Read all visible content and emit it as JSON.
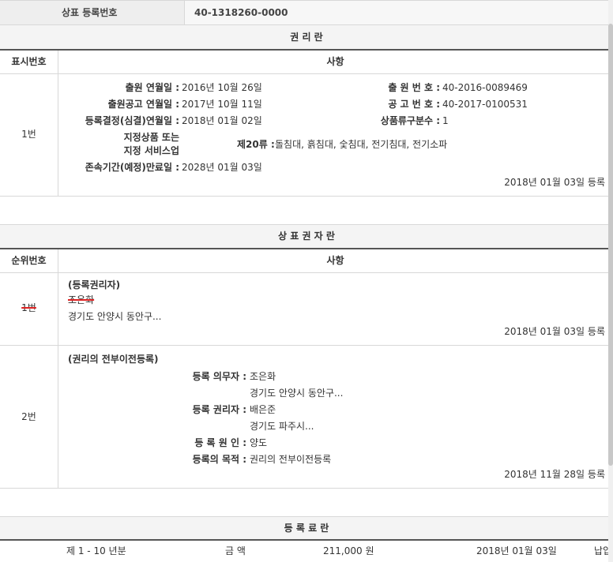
{
  "reg_header": {
    "label": "상표 등록번호",
    "value": "40-1318260-0000"
  },
  "rights": {
    "title": "권 리 란",
    "col_num": "표시번호",
    "col_content": "사항",
    "row_num": "1번",
    "fields_left": [
      {
        "label": "출원 연월일 :",
        "value": "2016년 10월 26일"
      },
      {
        "label": "출원공고 연월일 :",
        "value": "2017년 10월 11일"
      },
      {
        "label": "등록결정(심결)연월일 :",
        "value": "2018년 01월 02일"
      },
      {
        "label": "존속기간(예정)만료일 :",
        "value": "2028년 01월 03일"
      }
    ],
    "fields_right": [
      {
        "label": "출 원 번 호 :",
        "value": "40-2016-0089469"
      },
      {
        "label": "공 고 번 호 :",
        "value": "40-2017-0100531"
      },
      {
        "label": "상품류구분수 :",
        "value": "1"
      }
    ],
    "designated_label_1": "지정상품 또는",
    "designated_label_2": "지정 서비스업",
    "designated_class": "제20류 :",
    "designated_items": "돌침대, 흙침대, 숯침대, 전기침대, 전기소파",
    "reg_date": "2018년 01월 03일 등록"
  },
  "owners": {
    "title": "상 표 권 자 란",
    "col_num": "순위번호",
    "col_content": "사항",
    "row1": {
      "num": "1번",
      "heading": "(등록권리자)",
      "name": "조은화",
      "address": "경기도 안양시 동안구...",
      "date": "2018년 01월 03일 등록"
    },
    "row2": {
      "num": "2번",
      "heading": "(권리의 전부이전등록)",
      "obligor_label": "등록 의무자 :",
      "obligor_name": "조은화",
      "obligor_addr": "경기도 안양시 동안구...",
      "holder_label": "등록 권리자 :",
      "holder_name": "배은준",
      "holder_addr": "경기도 파주시...",
      "cause_label": "등 록 원 인 :",
      "cause_value": "양도",
      "purpose_label": "등록의 목적 :",
      "purpose_value": "권리의 전부이전등록",
      "date": "2018년 11월 28일 등록"
    }
  },
  "fees": {
    "title": "등 록 료 란",
    "period": "제 1 - 10 년분",
    "amount_label": "금 액",
    "amount": "211,000 원",
    "date": "2018년 01월 03일",
    "status": "납입"
  }
}
